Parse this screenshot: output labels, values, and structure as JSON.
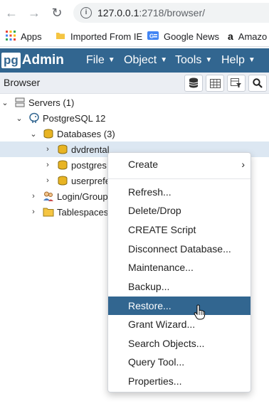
{
  "browser": {
    "url_host": "127.0.0.1",
    "url_path": ":2718/browser/",
    "bookmarks": [
      {
        "label": "Apps",
        "icon": "apps-grid-icon"
      },
      {
        "label": "Imported From IE",
        "icon": "folder-icon"
      },
      {
        "label": "Google News",
        "icon": "google-news-icon"
      },
      {
        "label": "Amazo",
        "icon": "amazon-icon"
      }
    ]
  },
  "header": {
    "logo_pg": "pg",
    "logo_admin": "Admin",
    "menus": [
      "File",
      "Object",
      "Tools",
      "Help"
    ],
    "brand_color": "#326690"
  },
  "panel": {
    "title": "Browser"
  },
  "tree": {
    "servers": "Servers (1)",
    "server": "PostgreSQL 12",
    "databases": "Databases (3)",
    "db1": "dvdrental",
    "db2": "postgres",
    "db3": "userprefe",
    "login": "Login/Group",
    "tablespaces": "Tablespaces"
  },
  "context_menu": {
    "create": "Create",
    "items": [
      "Refresh...",
      "Delete/Drop",
      "CREATE Script",
      "Disconnect Database...",
      "Maintenance...",
      "Backup...",
      "Restore...",
      "Grant Wizard...",
      "Search Objects...",
      "Query Tool...",
      "Properties..."
    ],
    "highlighted": "Restore..."
  }
}
